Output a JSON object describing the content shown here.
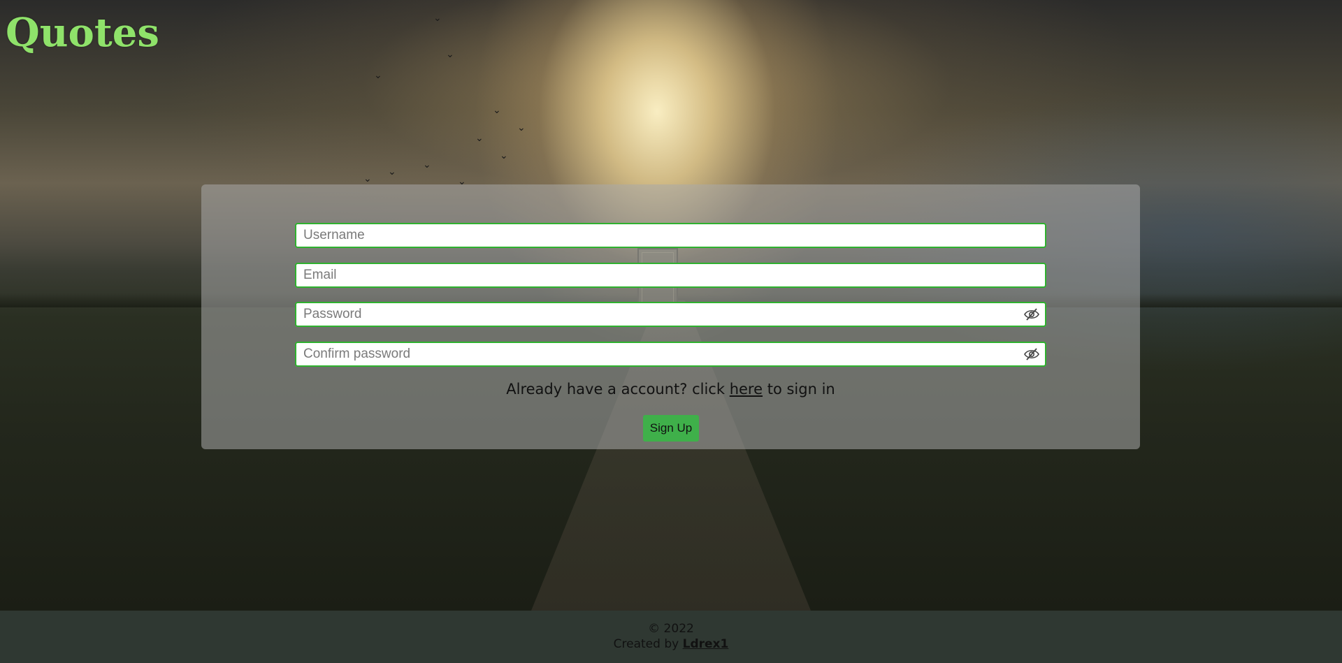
{
  "site": {
    "title": "Quotes"
  },
  "form": {
    "username_placeholder": "Username",
    "email_placeholder": "Email",
    "password_placeholder": "Password",
    "confirm_password_placeholder": "Confirm password",
    "signin_prefix": "Already have a account? click",
    "signin_link": "here",
    "signin_suffix": "to sign in",
    "submit_label": "Sign Up"
  },
  "footer": {
    "copyright": "© 2022",
    "created_by_prefix": "Created by",
    "author": "Ldrex1"
  },
  "colors": {
    "title": "#8fe26a",
    "field_border": "#2fb12f",
    "button": "#3fb04a",
    "footer_bg": "#2f3832"
  },
  "icons": {
    "password_toggle": "eye-slash-icon"
  }
}
